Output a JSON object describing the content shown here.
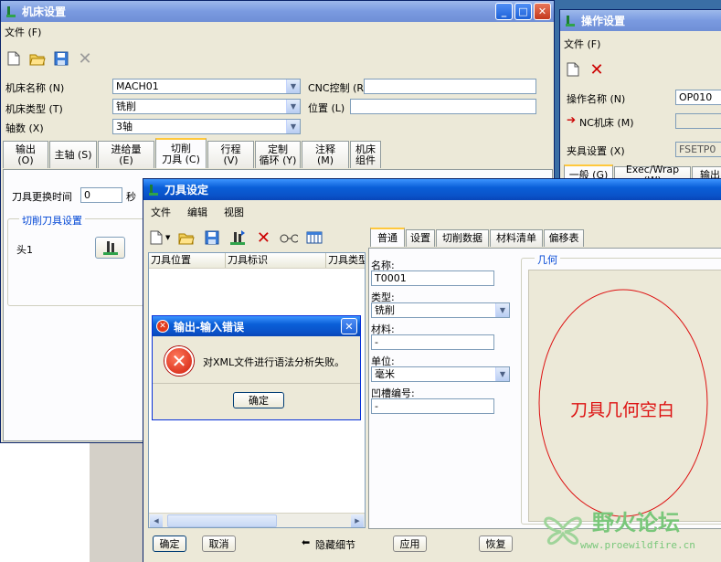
{
  "machine_window": {
    "title": "机床设置",
    "menu": [
      "文件 (F)"
    ],
    "fields": {
      "name_label": "机床名称 (N)",
      "name_value": "MACH01",
      "type_label": "机床类型 (T)",
      "type_value": "铣削",
      "axes_label": "轴数 (X)",
      "axes_value": "3轴",
      "cnc_label": "CNC控制 (R)",
      "cnc_value": "",
      "pos_label": "位置 (L)",
      "pos_value": ""
    },
    "tabs": [
      "输出 (O)",
      "主轴 (S)",
      "进给量 (E)",
      "切削\n刀具 (C)",
      "行程 (V)",
      "定制\n循环 (Y)",
      "注释 (M)",
      "机床\n组件"
    ],
    "tool_change_label": "刀具更换时间",
    "tool_change_value": "0",
    "tool_change_unit": "秒",
    "group_title": "切削刀具设置",
    "head_label": "头1"
  },
  "operation_window": {
    "title": "操作设置",
    "menu": [
      "文件 (F)"
    ],
    "name_label": "操作名称 (N)",
    "name_value": "OP010",
    "nc_label": "NC机床 (M)",
    "nc_value": "",
    "fixture_label": "夹具设置 (X)",
    "fixture_value": "FSETP0",
    "tabs": [
      "一般 (G)",
      "Exec/Wrap (W)",
      "输出"
    ]
  },
  "tool_window": {
    "title": "刀具设定",
    "menu": [
      "文件",
      "编辑",
      "视图"
    ],
    "list_headers": [
      "刀具位置",
      "刀具标识",
      "刀具类型"
    ],
    "tabs": [
      "普通",
      "设置",
      "切削数据",
      "材料清单",
      "偏移表"
    ],
    "name_label": "名称:",
    "name_value": "T0001",
    "type_label": "类型:",
    "type_value": "铣削",
    "material_label": "材料:",
    "material_value": "-",
    "unit_label": "单位:",
    "unit_value": "毫米",
    "groove_label": "凹槽编号:",
    "groove_value": "-",
    "geometry_title": "几何",
    "geometry_annotation": "刀具几何空白",
    "buttons": {
      "ok": "确定",
      "cancel": "取消",
      "hide": "隐藏细节",
      "apply": "应用",
      "restore": "恢复"
    }
  },
  "error_dialog": {
    "title": "输出-输入错误",
    "message": "对XML文件进行语法分析失败。",
    "ok": "确定"
  },
  "watermark": {
    "title": "野火论坛",
    "url": "www.proewildfire.cn"
  }
}
